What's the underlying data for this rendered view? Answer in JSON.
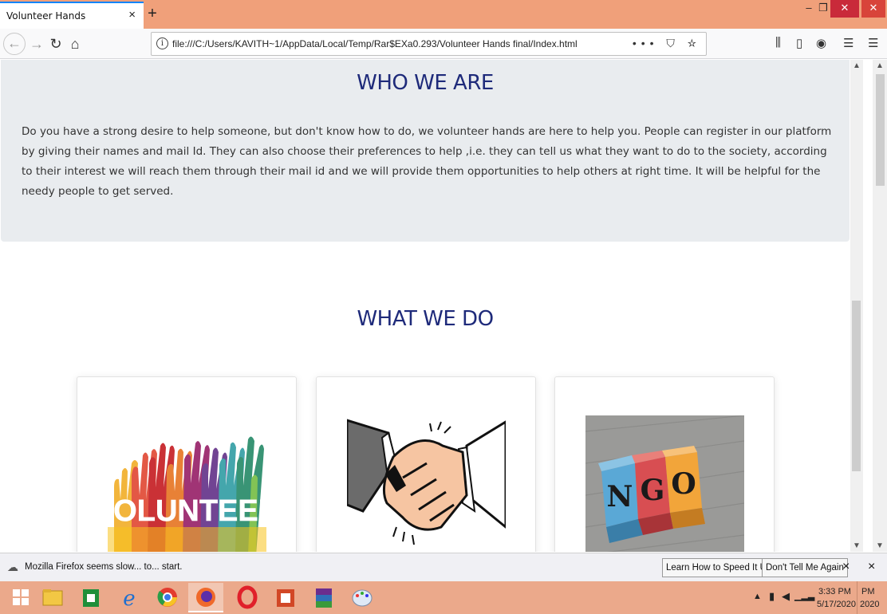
{
  "browser": {
    "tab_title": "Volunteer Hands",
    "tab_close": "×",
    "new_tab": "+",
    "url": "file:///C:/Users/KAVITH~1/AppData/Local/Temp/Rar$EXa0.293/Volunteer Hands final/Index.html",
    "url_actions": "••• ⛉ ☆",
    "info_icon": "i"
  },
  "page": {
    "who_title": "WHO WE ARE",
    "who_text": "Do you have a strong desire to help someone, but don't know how to do, we volunteer hands are here to help you. People can register in our platform by giving their names and mail Id. They can also choose their preferences to help ,i.e. they can tell us what they want to do to the society, according to their interest we will reach them through their mail id and we will provide them opportunities to help others at right time. It will be helpful for the needy people to get served.",
    "what_title": "WHAT WE DO",
    "cards": [
      {
        "image": "volunteer-hands-image",
        "overlay_text": "VOLUNTEER"
      },
      {
        "image": "handshake-image"
      },
      {
        "image": "ngo-blocks-image",
        "letters": [
          "N",
          "G",
          "O"
        ]
      }
    ]
  },
  "notification": {
    "text": "Mozilla Firefox seems slow... to... start.",
    "button_learn": "Learn How to Speed It Up",
    "button_dont": "Don't Tell Me Again",
    "close": "×"
  },
  "taskbar": {
    "time": "3:33 PM",
    "date": "5/17/2020",
    "edge_time": "PM",
    "edge_date": "2020"
  },
  "colors": {
    "title_blue": "#1e2a7a",
    "titlebar": "#f0a07a",
    "taskbar": "#eba98b",
    "section_bg": "#e9ecef"
  }
}
